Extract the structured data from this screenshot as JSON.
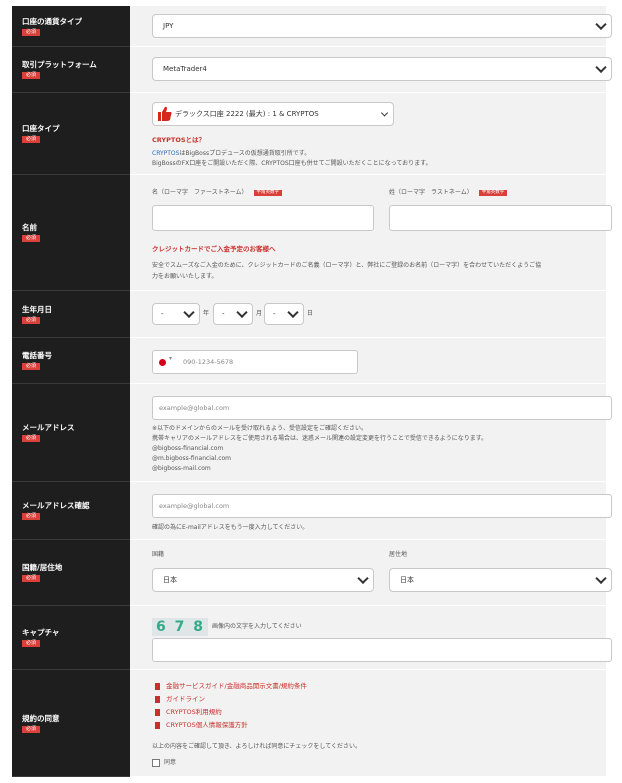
{
  "required_badge": "必須",
  "required_roman_badge": "半角英数字",
  "currency": {
    "label": "口座の通貨タイプ",
    "value": "JPY"
  },
  "platform": {
    "label": "取引プラットフォーム",
    "value": "MetaTrader4"
  },
  "account_type": {
    "label": "口座タイプ",
    "value": "デラックス口座 2222 (最大) : 1 & CRYPTOS",
    "heading": "CRYPTOSとは？",
    "desc_prefix": "CRYPTOS",
    "desc_line1": "はBigBossプロデュースの仮想通貨取引所です。",
    "desc_line2": "BigBossのFX口座をご開設いただく際、CRYPTOS口座も併せてご開設いただくことになっております。"
  },
  "name": {
    "label": "名前",
    "first_label": "名（ローマ字　ファーストネーム）",
    "last_label": "姓（ローマ字　ラストネーム）",
    "card_heading": "クレジットカードでご入金予定のお客様へ",
    "card_note_1": "安全でスムーズなご入金のために、クレジットカードのご名義（ローマ字）と、弊社にご登録のお名前（ローマ字）を合わせていただくようご協",
    "card_note_2": "力をお願いいたします。"
  },
  "birth": {
    "label": "生年月日",
    "year_value": "-",
    "month_value": "-",
    "day_value": "-",
    "year_unit": "年",
    "month_unit": "月",
    "day_unit": "日"
  },
  "phone": {
    "label": "電話番号",
    "placeholder": "090-1234-5678",
    "flag_color": "#d0021b"
  },
  "email": {
    "label": "メールアドレス",
    "placeholder": "example@global.com",
    "note_1": "※以下のドメインからのメールを受け取れるよう、受信設定をご確認ください。",
    "note_2": "携帯キャリアのメールアドレスをご使用される場合は、迷惑メール関連の設定変更を行うことで受信できるようになります。",
    "domains": [
      "@bigboss-financial.com",
      "@m.bigboss-financial.com",
      "@bigboss-mail.com"
    ]
  },
  "email_confirm": {
    "label": "メールアドレス確認",
    "placeholder": "example@global.com",
    "note": "確認の為にE-mailアドレスをもう一度入力してください。"
  },
  "country": {
    "label": "国籍/居住地",
    "nationality_label": "国籍",
    "nationality_value": "日本",
    "residence_label": "居住地",
    "residence_value": "日本"
  },
  "captcha": {
    "label": "キャプチャ",
    "image_text": "6 7 8",
    "prompt": "画像内の文字を入力してください"
  },
  "terms": {
    "label": "規約の同意",
    "docs": [
      "金融サービスガイド/金融商品開示文書/規約条件",
      "ガイドライン",
      "CRYPTOS利用規約",
      "CRYPTOS個人情報保護方針"
    ],
    "instruction": "以上の内容をご確認して頂き、よろしければ同意にチェックをしてください。",
    "agree_label": "同意"
  }
}
